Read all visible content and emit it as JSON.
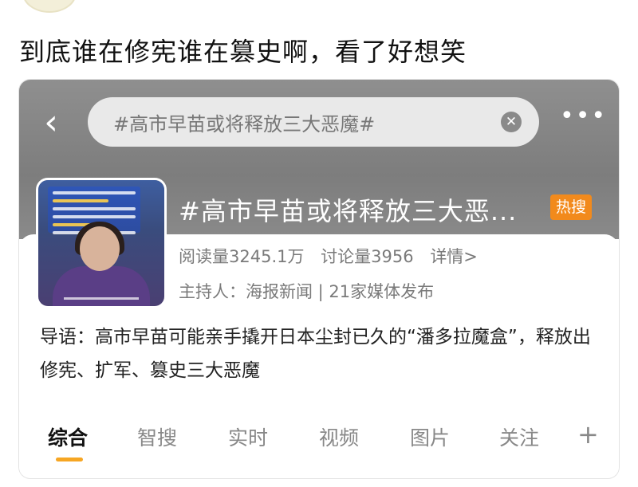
{
  "post": {
    "text": "到底谁在修宪谁在篡史啊，看了好想笑"
  },
  "topic_page": {
    "back_icon": "chevron-left-icon",
    "search": {
      "query": "#高市早苗或将释放三大恶魔#"
    },
    "more_icon": "more-dots-icon",
    "topic": {
      "title": "#高市早苗或将释放三大恶...",
      "badge": "热搜",
      "reads": "阅读量3245.1万",
      "discussions": "讨论量3956",
      "details": "详情>",
      "host": "主持人：海报新闻 | 21家媒体发布",
      "intro": "导语：高市早苗可能亲手撬开日本尘封已久的“潘多拉魔盒”，释放出修宪、扩军、篡史三大恶魔"
    },
    "tabs": [
      "综合",
      "智搜",
      "实时",
      "视频",
      "图片",
      "关注"
    ],
    "active_tab": "综合",
    "colors": {
      "accent": "#f6a623",
      "badge": "#f28a1c",
      "header": "#858585"
    }
  }
}
